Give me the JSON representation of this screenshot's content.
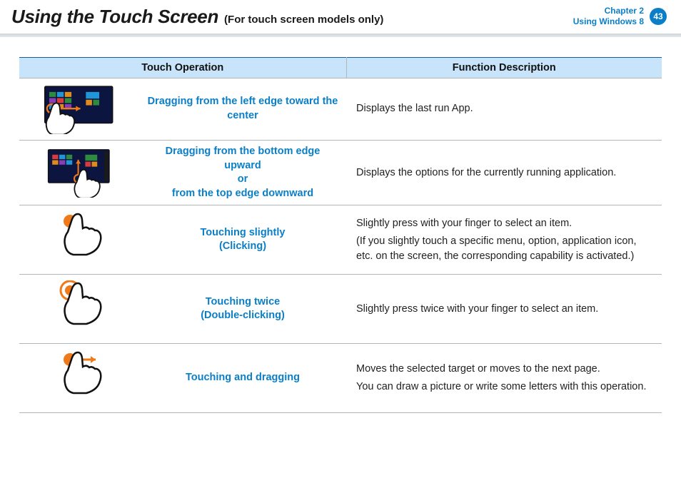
{
  "header": {
    "title": "Using the Touch Screen",
    "subtitle": "(For touch screen models only)",
    "chapter_line1": "Chapter 2",
    "chapter_line2": "Using Windows 8",
    "page_number": "43"
  },
  "table": {
    "col1": "Touch Operation",
    "col2": "Function Description",
    "rows": [
      {
        "label": "Dragging from the left edge toward the center",
        "desc": [
          "Displays the last run App."
        ]
      },
      {
        "label": "Dragging from the bottom edge upward\nor\nfrom the top edge downward",
        "desc": [
          "Displays the options for the currently running application."
        ]
      },
      {
        "label": "Touching slightly\n(Clicking)",
        "desc": [
          "Slightly press with your finger to select an item.",
          "(If you slightly touch a specific menu, option, application icon, etc. on the screen, the corresponding capability is activated.)"
        ]
      },
      {
        "label": "Touching twice\n(Double-clicking)",
        "desc": [
          "Slightly press twice with your finger to select an item."
        ]
      },
      {
        "label": "Touching and dragging",
        "desc": [
          "Moves the selected target or moves to the next page.",
          "You can draw a picture or write some letters with this operation."
        ]
      }
    ]
  }
}
